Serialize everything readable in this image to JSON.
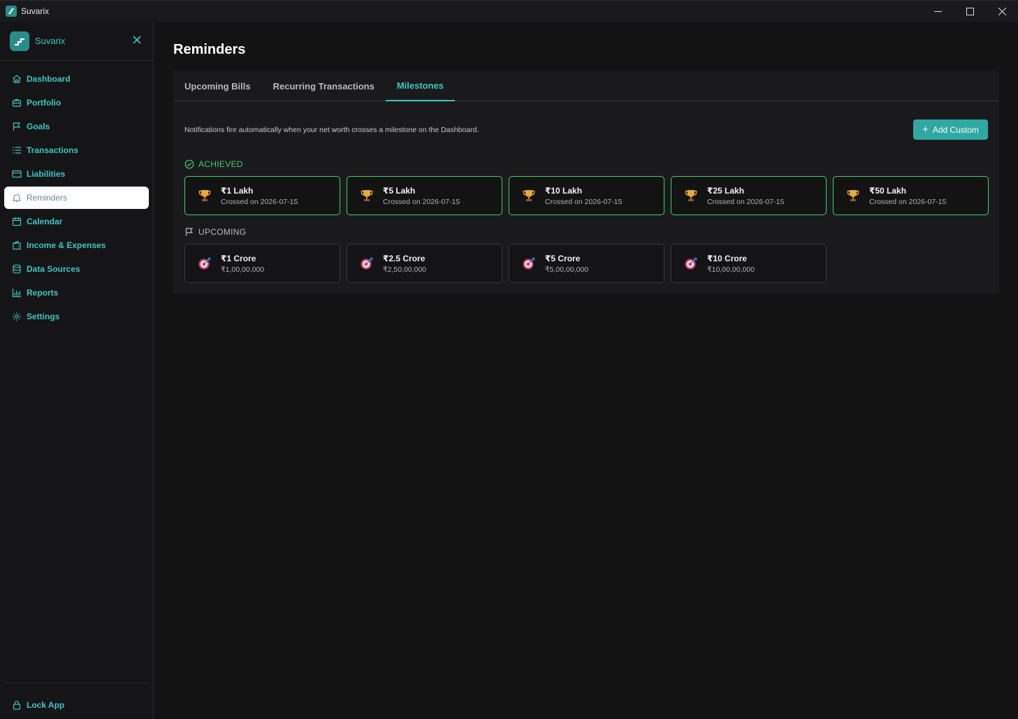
{
  "window": {
    "title": "Suvarix"
  },
  "sidebar": {
    "brand": "Suvarix",
    "items": [
      {
        "label": "Dashboard",
        "icon": "home-icon"
      },
      {
        "label": "Portfolio",
        "icon": "briefcase-icon"
      },
      {
        "label": "Goals",
        "icon": "flag-icon"
      },
      {
        "label": "Transactions",
        "icon": "list-icon"
      },
      {
        "label": "Liabilities",
        "icon": "credit-card-icon"
      },
      {
        "label": "Reminders",
        "icon": "bell-icon",
        "active": true
      },
      {
        "label": "Calendar",
        "icon": "calendar-icon"
      },
      {
        "label": "Income & Expenses",
        "icon": "wallet-icon"
      },
      {
        "label": "Data Sources",
        "icon": "database-icon"
      },
      {
        "label": "Reports",
        "icon": "bar-chart-icon"
      },
      {
        "label": "Settings",
        "icon": "gear-icon"
      }
    ],
    "lock": "Lock App"
  },
  "main": {
    "title": "Reminders",
    "tabs": [
      {
        "label": "Upcoming Bills"
      },
      {
        "label": "Recurring Transactions"
      },
      {
        "label": "Milestones",
        "active": true
      }
    ],
    "note": "Notifications fire automatically when your net worth crosses a milestone on the Dashboard.",
    "add_button": "Add Custom",
    "achieved_label": "ACHIEVED",
    "upcoming_label": "UPCOMING",
    "achieved": [
      {
        "title": "₹1 Lakh",
        "sub": "Crossed on 2026-07-15"
      },
      {
        "title": "₹5 Lakh",
        "sub": "Crossed on 2026-07-15"
      },
      {
        "title": "₹10 Lakh",
        "sub": "Crossed on 2026-07-15"
      },
      {
        "title": "₹25 Lakh",
        "sub": "Crossed on 2026-07-15"
      },
      {
        "title": "₹50 Lakh",
        "sub": "Crossed on 2026-07-15"
      }
    ],
    "upcoming": [
      {
        "title": "₹1 Crore",
        "sub": "₹1,00,00,000"
      },
      {
        "title": "₹2.5 Crore",
        "sub": "₹2,50,00,000"
      },
      {
        "title": "₹5 Crore",
        "sub": "₹5,00,00,000"
      },
      {
        "title": "₹10 Crore",
        "sub": "₹10,00,00,000"
      }
    ]
  },
  "colors": {
    "accent": "#3fc5bf",
    "success": "#3ecf6c",
    "button": "#2fa8a2"
  }
}
